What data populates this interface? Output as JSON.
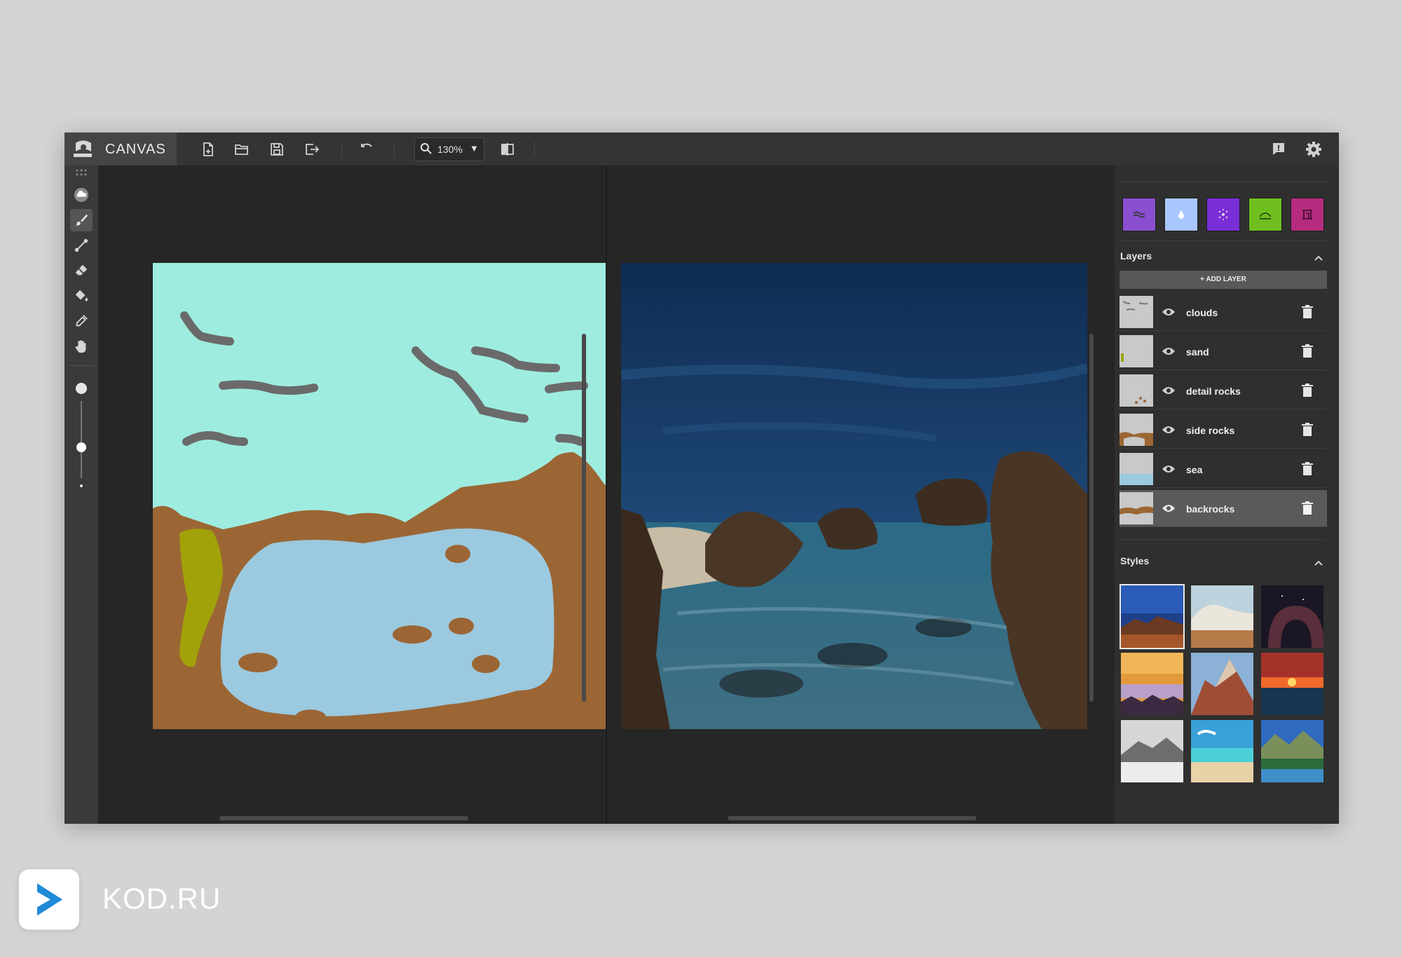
{
  "app": {
    "brand": "CANVAS",
    "zoom": "130%"
  },
  "toolbar_top": {
    "icons": [
      "new-file-icon",
      "open-folder-icon",
      "save-icon",
      "export-icon",
      "undo-icon",
      "search-icon",
      "compare-icon",
      "feedback-icon",
      "settings-icon"
    ]
  },
  "tools": [
    "grip-icon",
    "material-cloud-icon",
    "brush-icon",
    "line-icon",
    "eraser-icon",
    "fill-bucket-icon",
    "eyedropper-icon",
    "hand-icon"
  ],
  "brush_size": {
    "level": 0.5
  },
  "material_swatches": [
    {
      "name": "water",
      "color": "#8a4fd0"
    },
    {
      "name": "drop",
      "color": "#a9c7ff"
    },
    {
      "name": "sparkle",
      "color": "#7a2ed8"
    },
    {
      "name": "hill",
      "color": "#6fbf1f"
    },
    {
      "name": "structure",
      "color": "#b52c7e"
    }
  ],
  "layers": {
    "title": "Layers",
    "add_label": "+ ADD LAYER",
    "items": [
      {
        "name": "clouds"
      },
      {
        "name": "sand"
      },
      {
        "name": "detail rocks"
      },
      {
        "name": "side rocks"
      },
      {
        "name": "sea"
      },
      {
        "name": "backrocks",
        "selected": true
      }
    ]
  },
  "styles": {
    "title": "Styles"
  },
  "watermark": {
    "label": "KOD.RU"
  },
  "colors": {
    "sky": "#9eece0",
    "rock": "#9b6634",
    "water": "#9bc9df",
    "sand": "#a1a20a",
    "cloud": "#6a6a6a"
  }
}
